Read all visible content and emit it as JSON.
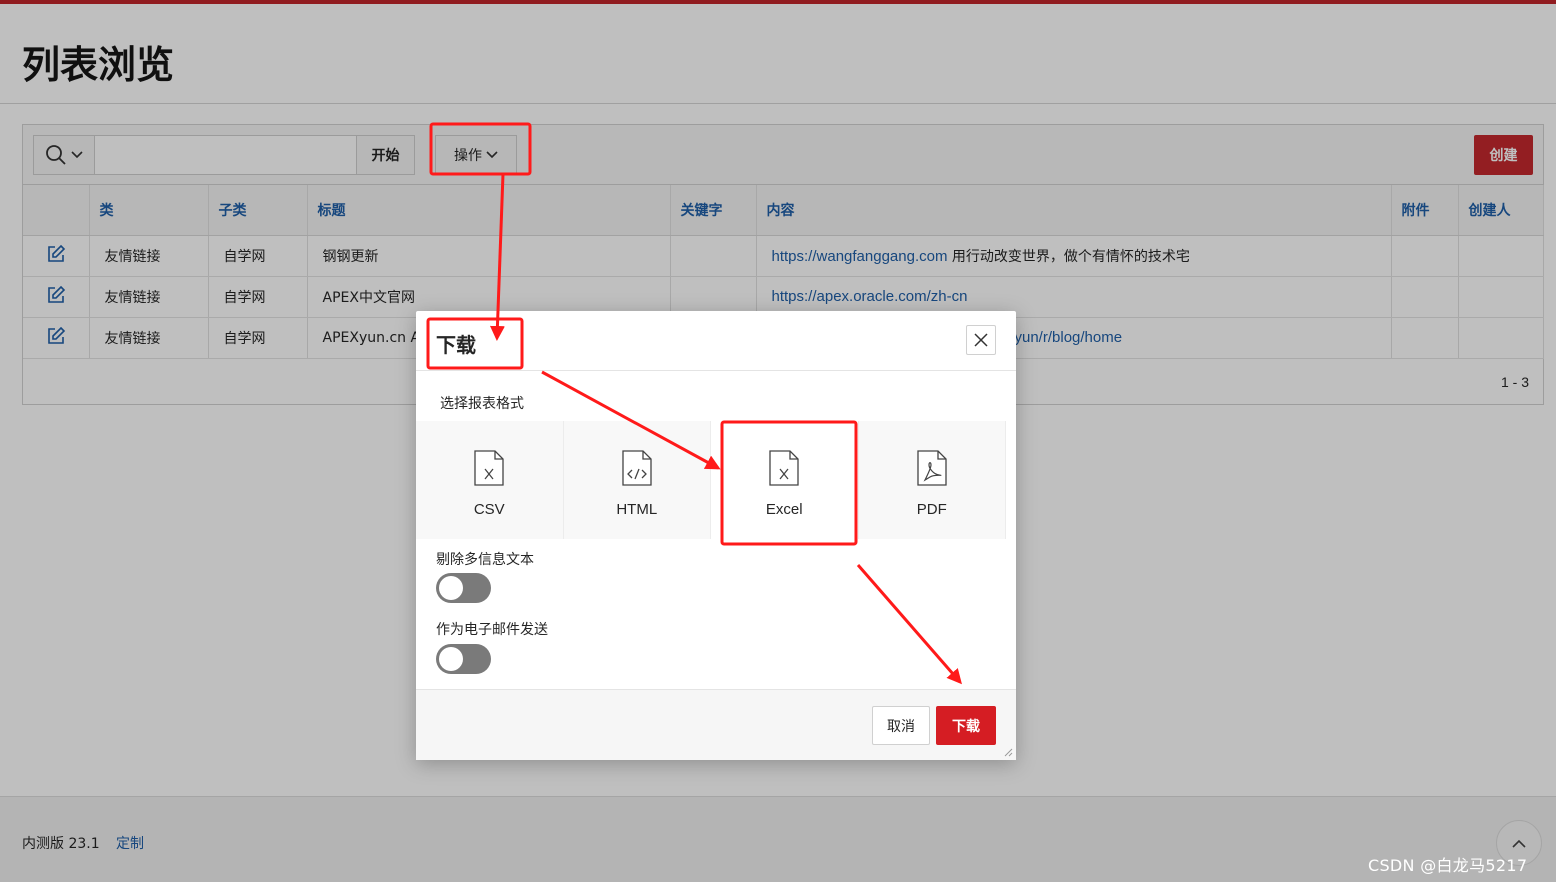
{
  "page": {
    "title": "列表浏览"
  },
  "toolbar": {
    "search_value": "",
    "go_label": "开始",
    "actions_label": "操作",
    "create_label": "创建",
    "icons": [
      "search-icon",
      "chevron-down-icon"
    ]
  },
  "table": {
    "columns": [
      "类",
      "子类",
      "标题",
      "关键字",
      "内容",
      "附件",
      "创建人"
    ],
    "rows": [
      {
        "category": "友情链接",
        "subcategory": "自学网",
        "title": "钢钢更新",
        "keyword": "",
        "content_link": "https://wangfanggang.com",
        "content_text": " 用行动改变世界，做个有情怀的技术宅"
      },
      {
        "category": "友情链接",
        "subcategory": "自学网",
        "title": "APEX中文官网",
        "keyword": "",
        "content_link": "https://apex.oracle.com/zh-cn",
        "content_text": ""
      },
      {
        "category": "友情链接",
        "subcategory": "自学网",
        "title": "APEXyun.cn A",
        "keyword": "",
        "content_link": "yun/r/blog/home",
        "content_text": ""
      }
    ],
    "pagination": "1 - 3"
  },
  "footer": {
    "version": "内测版 23.1",
    "customize": "定制",
    "watermark": "CSDN @白龙马5217"
  },
  "dialog": {
    "title": "下载",
    "format_label": "选择报表格式",
    "formats": [
      {
        "label": "CSV",
        "icon": "csv-file-icon"
      },
      {
        "label": "HTML",
        "icon": "html-file-icon"
      },
      {
        "label": "Excel",
        "icon": "excel-file-icon"
      },
      {
        "label": "PDF",
        "icon": "pdf-file-icon"
      }
    ],
    "selected_format": "Excel",
    "strip_rich_text_label": "剔除多信息文本",
    "strip_rich_text": false,
    "send_email_label": "作为电子邮件发送",
    "send_email": false,
    "cancel_label": "取消",
    "download_label": "下载"
  },
  "colors": {
    "brand_red": "#c5292e",
    "annotation_red": "#ff1a1a",
    "link_blue": "#1f5fa8"
  }
}
